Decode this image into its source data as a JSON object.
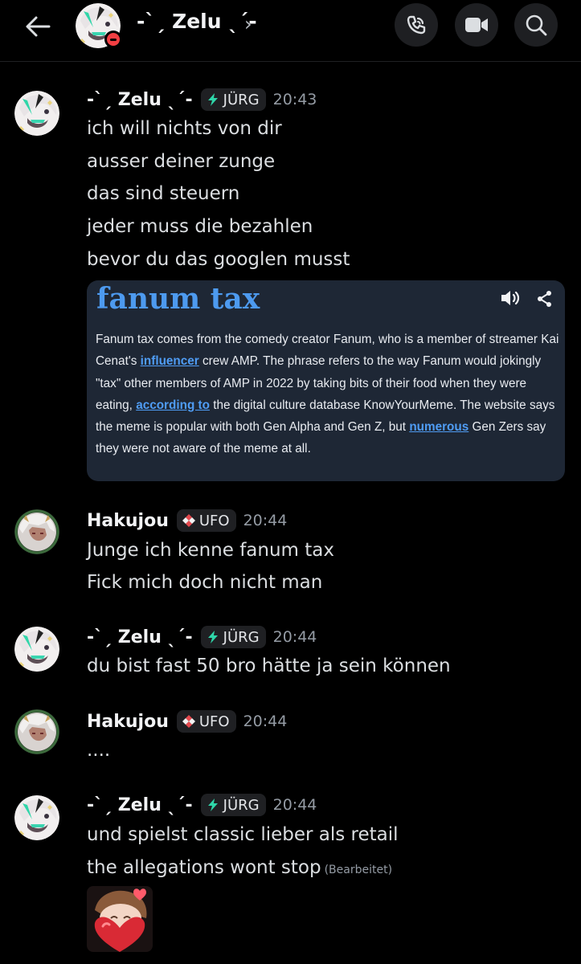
{
  "header": {
    "channel_name": "-ˋˏ Zelu ˎˊ-",
    "chevron": "›",
    "back_icon": "arrow-left-icon",
    "status": "do-not-disturb",
    "buttons": [
      "phone-call-icon",
      "video-camera-icon",
      "search-icon"
    ]
  },
  "colors": {
    "background": "#000000",
    "link": "#4f9cf4",
    "dnd": "#f23f43",
    "tag_bg": "#1f2023",
    "zelu_tag_icon": "#2fd6a9",
    "ufo_tag_icon": "#e5484d"
  },
  "messages": [
    {
      "author": "-ˋˏ Zelu ˎˊ-",
      "tag": "JÜRG",
      "time": "20:43",
      "lines": [
        "ich will nichts von dir",
        "ausser deiner zunge",
        "das sind steuern",
        "jeder muss die bezahlen",
        "bevor du das googlen musst"
      ],
      "embed": {
        "title": "fanum tax",
        "body": {
          "t1": "Fanum tax comes from the comedy creator Fanum, who is a member of streamer Kai Cenat's ",
          "l1": "influencer",
          "t2": " crew AMP. The phrase refers to the way Fanum would jokingly \"tax\" other members of AMP in 2022 by taking bits of their food when they were eating, ",
          "l2": "according to",
          "t3": " the digital culture database KnowYourMeme. The website says the meme is popular with both Gen Alpha and Gen Z, but ",
          "l3": "numerous",
          "t4": " Gen Zers say they were not aware of the meme at all."
        }
      }
    },
    {
      "author": "Hakujou",
      "tag": "UFO",
      "time": "20:44",
      "lines": [
        "Junge ich kenne fanum tax",
        "Fick mich doch nicht man"
      ]
    },
    {
      "author": "-ˋˏ Zelu ˎˊ-",
      "tag": "JÜRG",
      "time": "20:44",
      "lines": [
        "du bist fast 50 bro hätte ja sein können"
      ]
    },
    {
      "author": "Hakujou",
      "tag": "UFO",
      "time": "20:44",
      "lines": [
        "...."
      ]
    },
    {
      "author": "-ˋˏ Zelu ˎˊ-",
      "tag": "JÜRG",
      "time": "20:44",
      "lines": [
        "und spielst classic lieber als retail",
        "the allegations wont stop"
      ],
      "edited": "(Bearbeitet)",
      "attachment": "heart-sticker"
    }
  ]
}
